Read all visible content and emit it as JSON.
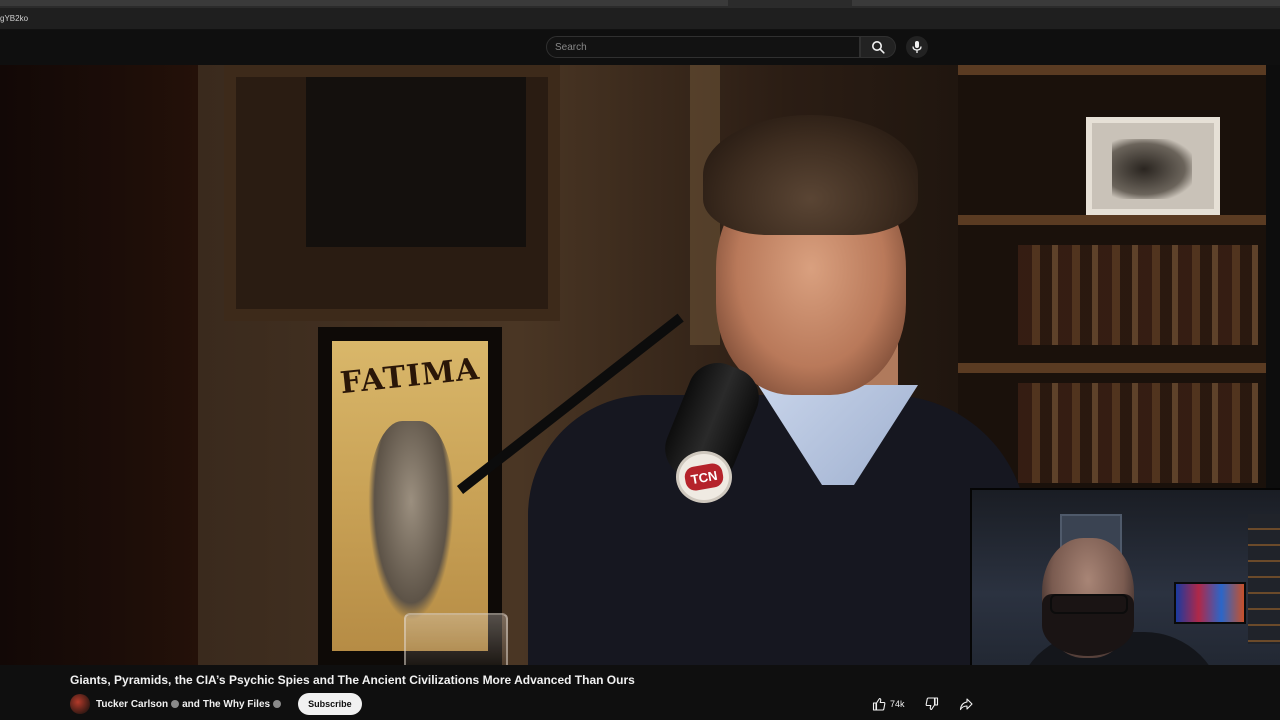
{
  "browser": {
    "url_fragment": "gYB2ko"
  },
  "header": {
    "search": {
      "placeholder": "Search"
    },
    "icons": {
      "search": "search-icon",
      "mic": "microphone-icon"
    }
  },
  "video": {
    "poster_text": "FATIMA",
    "mic_badge": "TCN",
    "title": "Giants, Pyramids, the CIA’s Psychic Spies and The Ancient Civilizations More Advanced Than Ours",
    "channel": {
      "name_primary": "Tucker Carlson",
      "and_text": "and",
      "name_secondary": "The Why Files",
      "subscribe_label": "Subscribe"
    },
    "actions": {
      "like_count": "74k",
      "like_icon": "thumbs-up-icon",
      "dislike_icon": "thumbs-down-icon",
      "share_icon": "share-icon"
    }
  },
  "colors": {
    "background": "#0f0f0f",
    "text": "#f1f1f1",
    "subscribe_bg": "#f1f1f1",
    "tcn_red": "#b5232b"
  }
}
